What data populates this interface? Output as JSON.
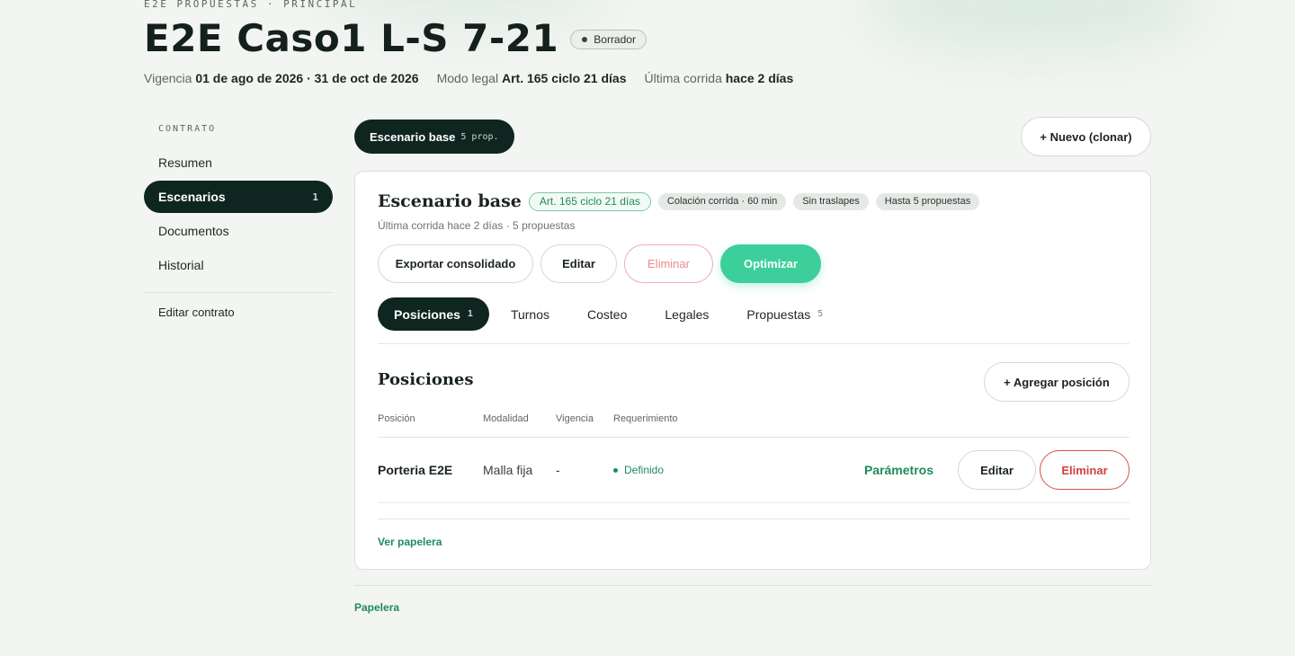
{
  "header": {
    "breadcrumb": "E2E PROPUESTAS · PRINCIPAL",
    "title": "E2E Caso1 L-S 7-21",
    "status": "Borrador",
    "meta": [
      {
        "label": "Vigencia",
        "value": "01 de ago de 2026 · 31 de oct de 2026"
      },
      {
        "label": "Modo legal",
        "value": "Art. 165 ciclo 21 días"
      },
      {
        "label": "Última corrida",
        "value": "hace 2 días"
      }
    ]
  },
  "sidebar": {
    "section": "CONTRATO",
    "items": [
      {
        "label": "Resumen",
        "count": ""
      },
      {
        "label": "Escenarios",
        "count": "1"
      },
      {
        "label": "Documentos",
        "count": ""
      },
      {
        "label": "Historial",
        "count": ""
      }
    ],
    "edit_contract": "Editar contrato"
  },
  "scenario_tabs": {
    "active_label": "Escenario base",
    "active_count": "5 prop.",
    "new_button": "+ Nuevo (clonar)"
  },
  "scenario": {
    "title": "Escenario base",
    "legal_chip": "Art. 165 ciclo 21 días",
    "chips": [
      "Colación corrida · 60 min",
      "Sin traslapes",
      "Hasta 5 propuestas"
    ],
    "subtitle": "Última corrida hace 2 días · 5 propuestas",
    "actions": {
      "export": "Exportar consolidado",
      "edit": "Editar",
      "delete": "Eliminar",
      "optimize": "Optimizar"
    },
    "tabs": [
      {
        "label": "Posiciones",
        "count": "1"
      },
      {
        "label": "Turnos",
        "count": ""
      },
      {
        "label": "Costeo",
        "count": ""
      },
      {
        "label": "Legales",
        "count": ""
      },
      {
        "label": "Propuestas",
        "count": "5"
      }
    ]
  },
  "positions": {
    "title": "Posiciones",
    "add_button": "+ Agregar posición",
    "columns": [
      "Posición",
      "Modalidad",
      "Vigencia",
      "Requerimiento"
    ],
    "rows": [
      {
        "name": "Porteria E2E",
        "mode": "Malla fija",
        "validity": "-",
        "requirement": "Definido",
        "params_link": "Parámetros",
        "edit": "Editar",
        "delete": "Eliminar"
      }
    ],
    "trash_link": "Ver papelera"
  },
  "footer": {
    "trash": "Papelera"
  },
  "colors": {
    "accent_dark": "#0f2620",
    "accent_green": "#1f8a5c",
    "optimize": "#3ccf9b",
    "danger": "#d0403e"
  }
}
